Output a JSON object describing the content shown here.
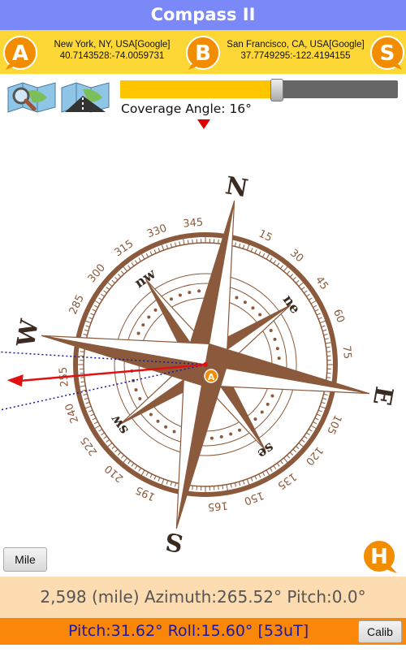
{
  "app": {
    "title": "Compass II"
  },
  "locations": {
    "a": {
      "badge": "A",
      "name": "New York, NY, USA[Google]",
      "coords": "40.7143528:-74.0059731"
    },
    "b": {
      "badge": "B",
      "name": "San Francisco, CA, USA[Google]",
      "coords": "37.7749295:-122.4194155"
    },
    "s": {
      "badge": "S"
    }
  },
  "toolbar": {
    "map_icon": "map-search-icon",
    "route_icon": "road-map-icon",
    "coverage_label": "Coverage Angle: 16°",
    "coverage_fraction": 0.56
  },
  "compass": {
    "north": "N",
    "south": "S",
    "east": "E",
    "west": "W",
    "nw": "nw",
    "ne": "ne",
    "sw": "sw",
    "se": "se",
    "degree_labels": [
      "15",
      "30",
      "45",
      "60",
      "75",
      "105",
      "120",
      "135",
      "150",
      "165",
      "195",
      "210",
      "225",
      "240",
      "255",
      "285",
      "300",
      "315",
      "330",
      "345"
    ],
    "degree_values": [
      15,
      30,
      45,
      60,
      75,
      105,
      120,
      135,
      150,
      165,
      195,
      210,
      225,
      240,
      255,
      285,
      300,
      315,
      330,
      345
    ],
    "marker_badge": "A",
    "colors": {
      "rose": "#8b5a3c",
      "arrow": "#e01010",
      "guide": "#1a1a9a"
    }
  },
  "azimuth": 265.52,
  "coverage_angle": 16,
  "buttons": {
    "mile": "Mile",
    "calib": "Calib",
    "help": "H"
  },
  "info": {
    "text": "2,598 (mile) Azimuth:265.52° Pitch:0.0°"
  },
  "status": {
    "text": "Pitch:31.62° Roll:15.60° [53uT]"
  }
}
